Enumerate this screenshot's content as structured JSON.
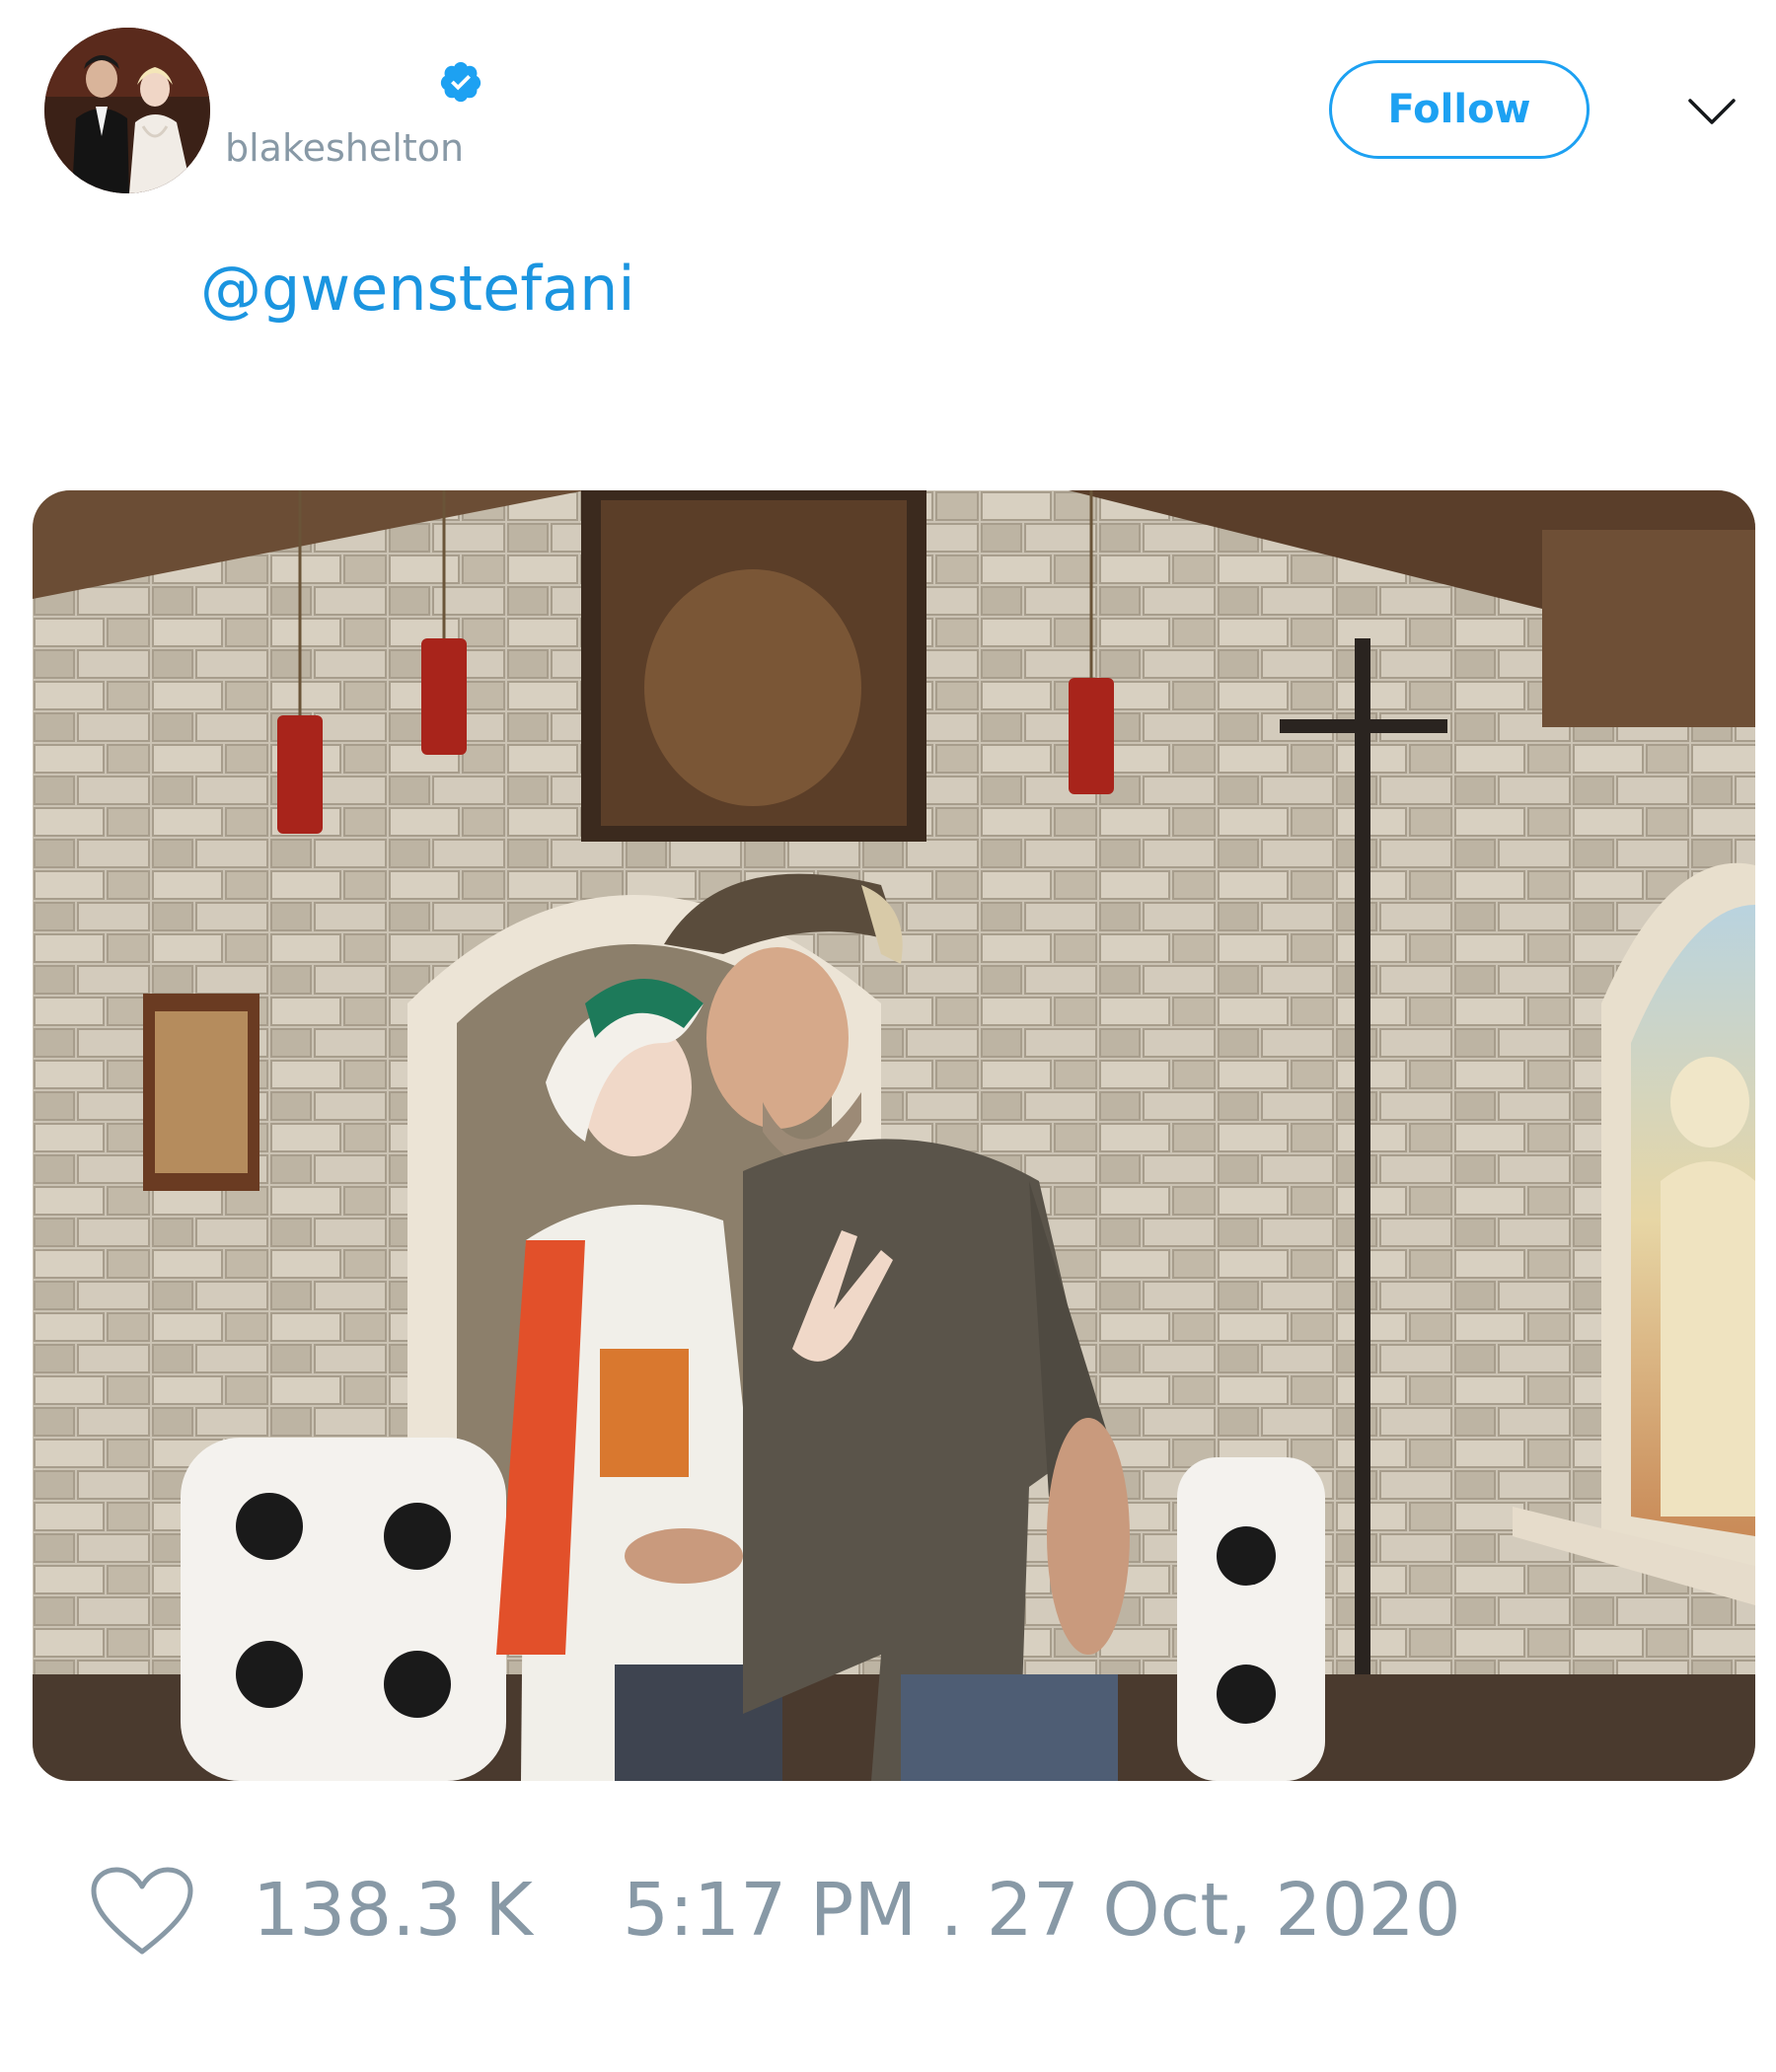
{
  "user": {
    "display_name": "",
    "handle": "blakeshelton",
    "verified": true,
    "avatar_icon": "profile-photo"
  },
  "header": {
    "follow_label": "Follow",
    "menu_icon": "chevron-down-icon"
  },
  "tweet": {
    "text": "@gwenstefani",
    "media_icon": "photo"
  },
  "footer": {
    "like_icon": "heart-icon",
    "likes": "138.3 K",
    "timestamp": "5:17 PM . 27 Oct, 2020"
  },
  "colors": {
    "accent": "#1da1f2",
    "link": "#1b95e0",
    "muted": "#8899a6"
  }
}
